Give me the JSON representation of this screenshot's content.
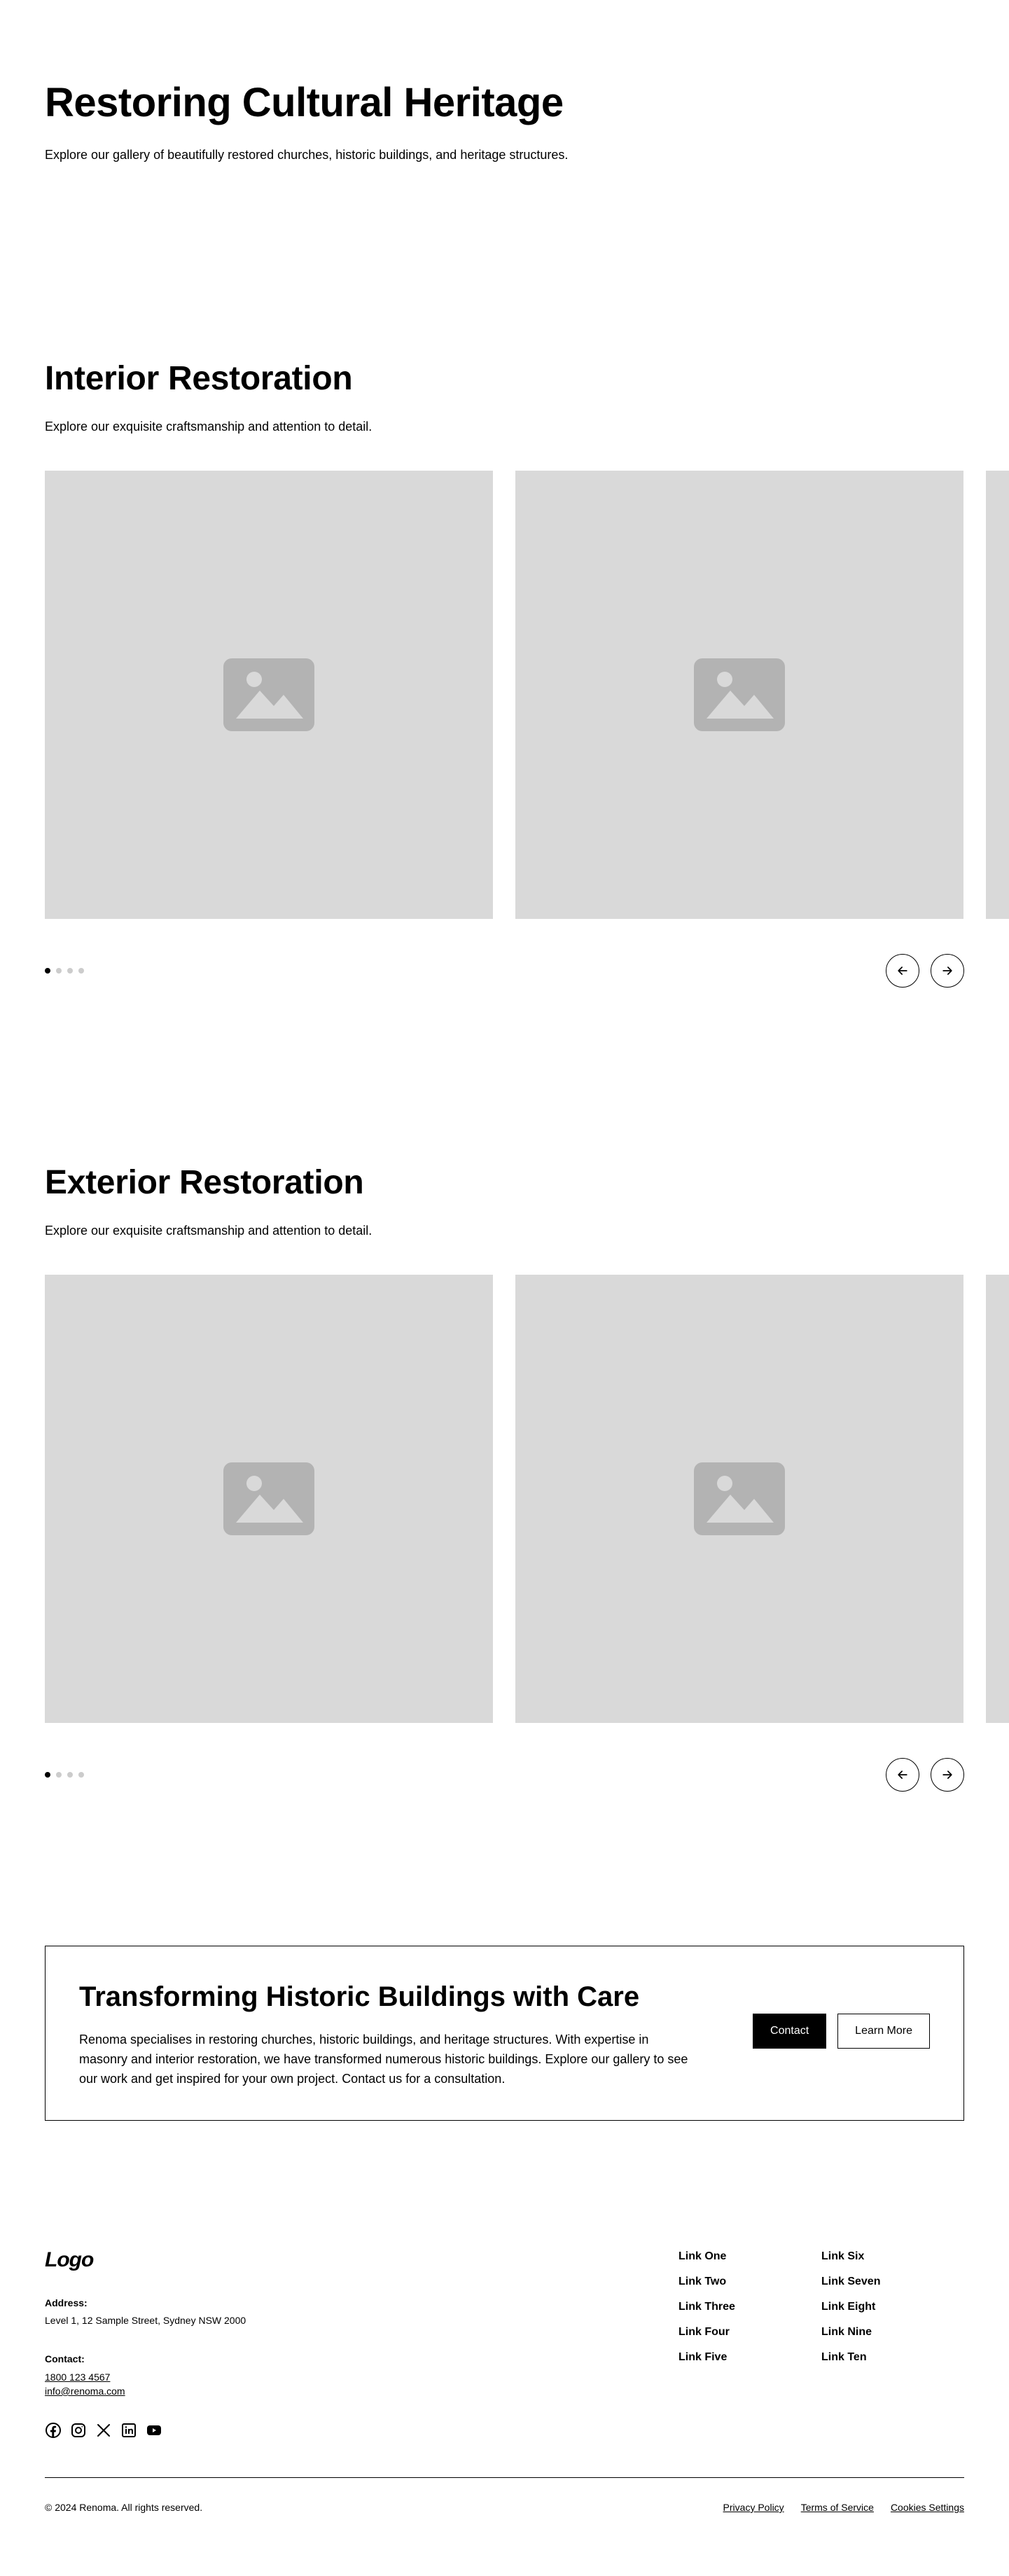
{
  "hero": {
    "title": "Restoring Cultural Heritage",
    "subtitle": "Explore our gallery of beautifully restored churches, historic buildings, and heritage structures."
  },
  "interior": {
    "title": "Interior Restoration",
    "subtitle": "Explore our exquisite craftsmanship and attention to detail.",
    "active_slide": 1,
    "slide_count": 4
  },
  "exterior": {
    "title": "Exterior Restoration",
    "subtitle": "Explore our exquisite craftsmanship and attention to detail.",
    "active_slide": 1,
    "slide_count": 4
  },
  "cta": {
    "title": "Transforming Historic Buildings with Care",
    "body": "Renoma specialises in restoring churches, historic buildings, and heritage structures. With expertise in masonry and interior restoration, we have transformed numerous historic buildings. Explore our gallery to see our work and get inspired for your own project. Contact us for a consultation.",
    "primary_label": "Contact",
    "secondary_label": "Learn More"
  },
  "footer": {
    "logo": "Logo",
    "address_label": "Address:",
    "address": "Level 1, 12 Sample Street, Sydney NSW 2000",
    "contact_label": "Contact:",
    "phone": "1800 123 4567",
    "email": "info@renoma.com",
    "social_icons": [
      "facebook-icon",
      "instagram-icon",
      "x-icon",
      "linkedin-icon",
      "youtube-icon"
    ],
    "links_col1": [
      "Link One",
      "Link Two",
      "Link Three",
      "Link Four",
      "Link Five"
    ],
    "links_col2": [
      "Link Six",
      "Link Seven",
      "Link Eight",
      "Link Nine",
      "Link Ten"
    ],
    "copyright": "© 2024 Renoma. All rights reserved.",
    "legal": {
      "privacy": "Privacy Policy",
      "terms": "Terms of Service",
      "cookies": "Cookies Settings"
    }
  },
  "colors": {
    "placeholder_bg": "#d9d9d9",
    "placeholder_icon": "#b3b3b3",
    "dot_inactive": "#cccccc",
    "text": "#000000"
  }
}
